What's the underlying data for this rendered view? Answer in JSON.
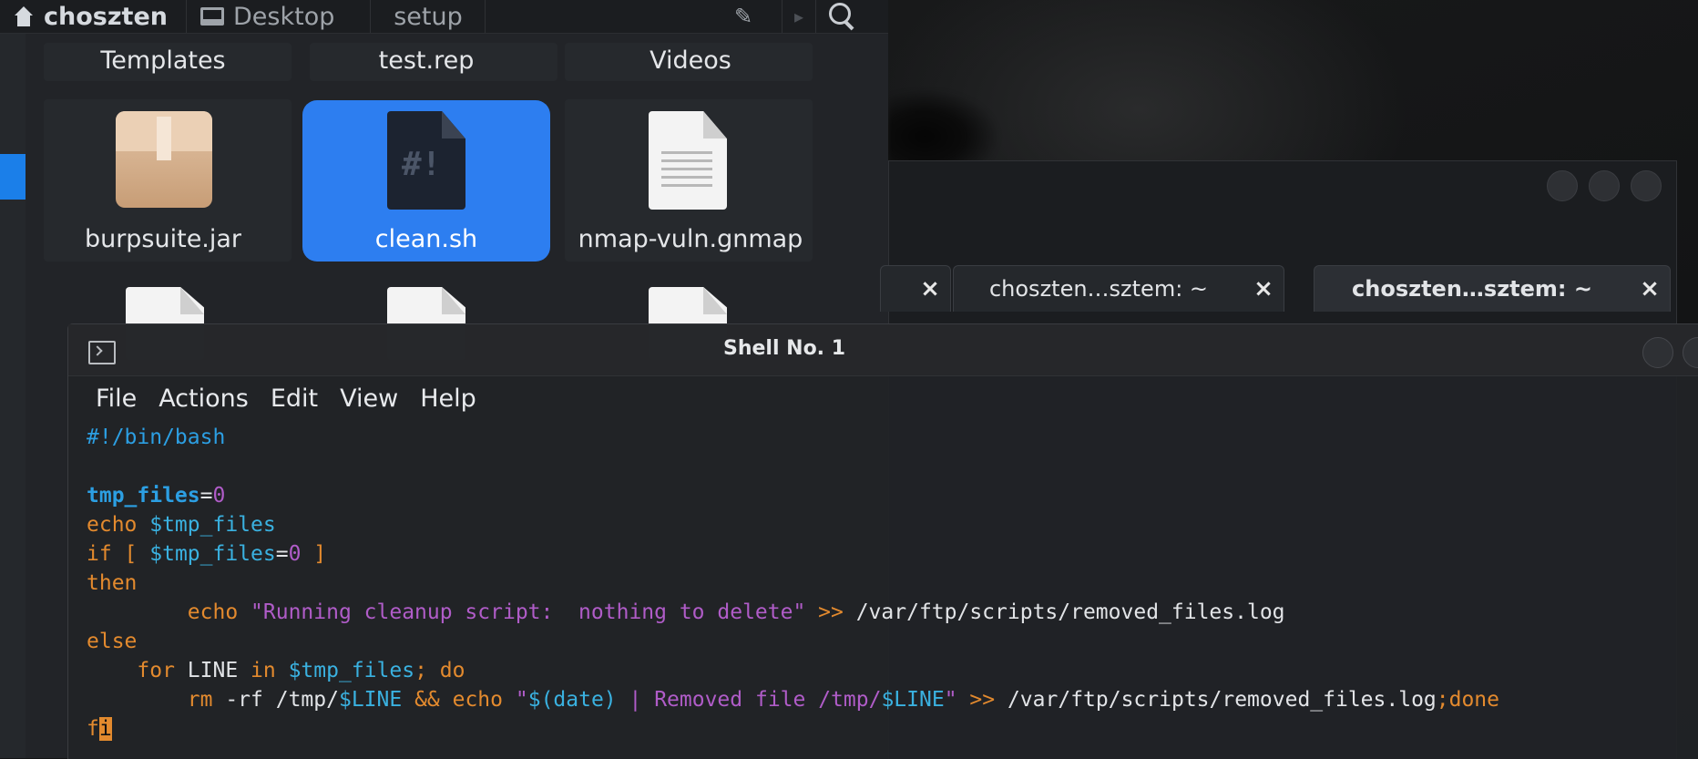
{
  "file_manager": {
    "breadcrumbs": [
      "choszten",
      "Desktop",
      "setup"
    ],
    "files": [
      {
        "name": "Templates"
      },
      {
        "name": "test.rep"
      },
      {
        "name": "Videos"
      },
      {
        "name": "burpsuite.jar",
        "icon": "archive-icon"
      },
      {
        "name": "clean.sh",
        "icon": "script-icon",
        "selected": true
      },
      {
        "name": "nmap-vuln.gnmap",
        "icon": "text-file-icon"
      }
    ],
    "accent_color": "#2d7ef0"
  },
  "background_terminal": {
    "tabs": [
      {
        "label": "",
        "close": "×"
      },
      {
        "label": "choszten…sztem: ~",
        "close": "×"
      },
      {
        "label": "choszten…sztem: ~",
        "close": "×",
        "active": true
      }
    ]
  },
  "terminal": {
    "title": "Shell No. 1",
    "menu": [
      "File",
      "Actions",
      "Edit",
      "View",
      "Help"
    ],
    "code": {
      "l1": "#!/bin/bash",
      "l3_var": "tmp_files",
      "l3_eq": "=",
      "l3_num": "0",
      "l4_kw": "echo",
      "l4_var": " $tmp_files",
      "l5_kw": "if [ ",
      "l5_var": "$tmp_files",
      "l5_eq": "=",
      "l5_num": "0",
      "l5_end": " ]",
      "l6": "then",
      "l7_indent": "        ",
      "l7_kw": "echo ",
      "l7_str": "\"Running cleanup script:  nothing to delete\"",
      "l7_op": " >> ",
      "l7_path": "/var/ftp/scripts/removed_files.log",
      "l8": "else",
      "l9_indent": "    ",
      "l9_kw": "for",
      "l9_plain": " LINE ",
      "l9_kw2": "in",
      "l9_var": " $tmp_files",
      "l9_kw3": "; do",
      "l10_indent": "        ",
      "l10_kw": "rm",
      "l10_plain": " -rf /tmp/",
      "l10_var": "$LINE",
      "l10_op": " && ",
      "l10_kw2": "echo ",
      "l10_str1": "\"",
      "l10_dollar": "$(date)",
      "l10_str2": " | Removed file /tmp/",
      "l10_var2": "$LINE",
      "l10_str3": "\"",
      "l10_op2": " >> ",
      "l10_path": "/var/ftp/scripts/removed_files.log",
      "l10_tail": ";done",
      "l11_a": "f",
      "l11_cursor": "i"
    }
  }
}
